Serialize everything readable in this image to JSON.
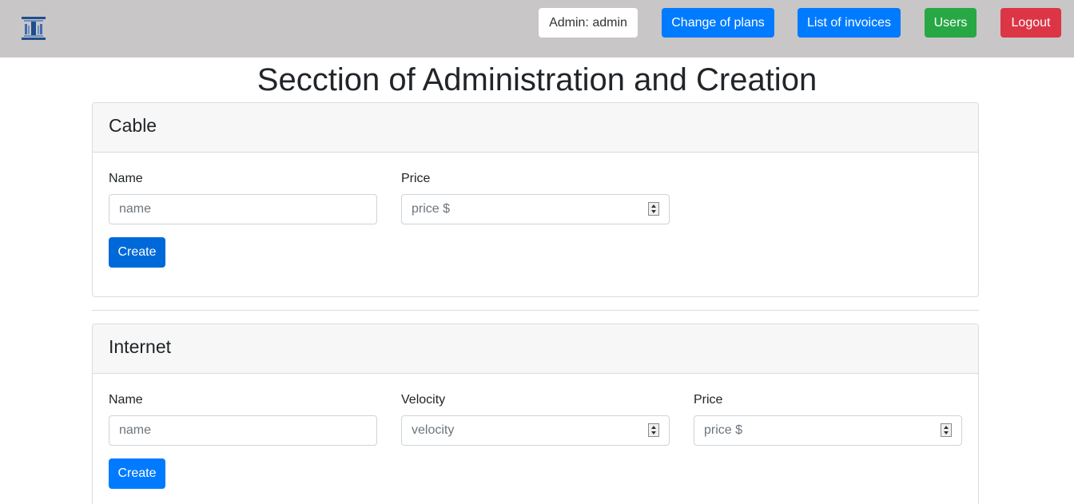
{
  "navbar": {
    "logo_icon": "building-columns-logo-icon",
    "admin_label": "Admin: admin",
    "change_plans_label": "Change of plans",
    "invoices_label": "List of invoices",
    "users_label": "Users",
    "logout_label": "Logout"
  },
  "page": {
    "title": "Secction of Administration and Creation"
  },
  "cable": {
    "title": "Cable",
    "name_label": "Name",
    "name_placeholder": "name",
    "name_value": "",
    "price_label": "Price",
    "price_placeholder": "price $",
    "price_value": "",
    "create_label": "Create"
  },
  "internet": {
    "title": "Internet",
    "name_label": "Name",
    "name_placeholder": "name",
    "name_value": "",
    "velocity_label": "Velocity",
    "velocity_placeholder": "velocity",
    "velocity_value": "",
    "price_label": "Price",
    "price_placeholder": "price $",
    "price_value": "",
    "create_label": "Create"
  },
  "colors": {
    "navbar_bg": "#c8c6c7",
    "primary": "#007bff",
    "success": "#28a745",
    "danger": "#dc3545"
  }
}
